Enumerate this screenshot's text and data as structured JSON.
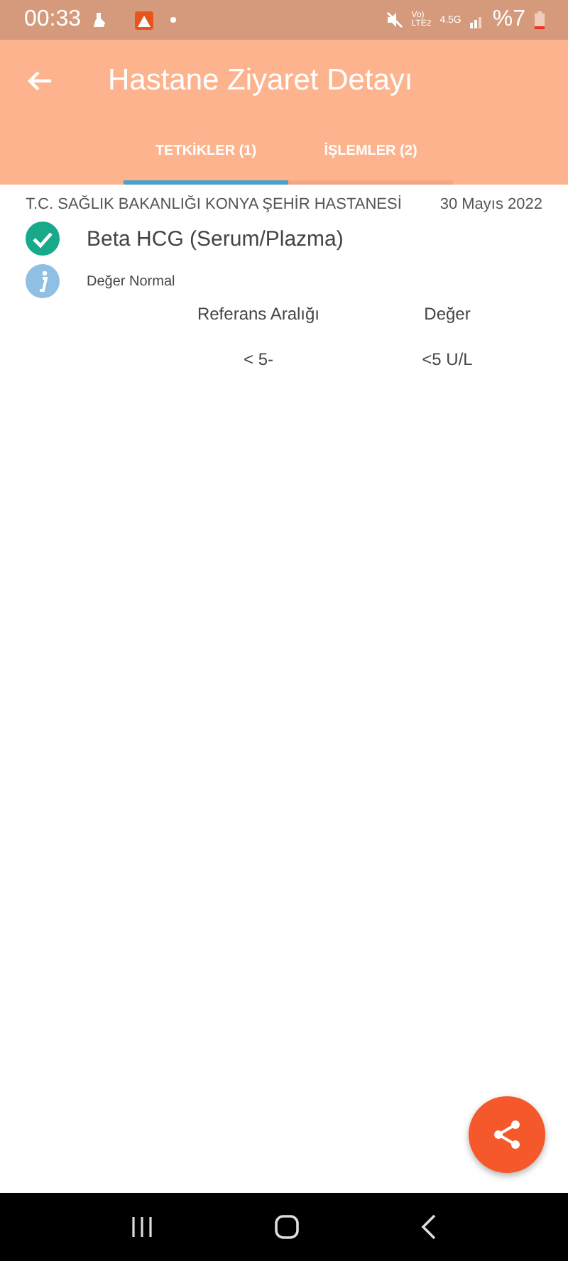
{
  "status_bar": {
    "time": "00:33",
    "volte_top": "Vo)",
    "volte_bottom": "LTE2",
    "network": "4.5G",
    "battery": "%7"
  },
  "app_bar": {
    "title": "Hastane Ziyaret Detayı"
  },
  "tabs": [
    {
      "label": "TETKİKLER (1)",
      "selected": true
    },
    {
      "label": "İŞLEMLER (2)",
      "selected": false
    }
  ],
  "visit": {
    "hospital": "T.C. SAĞLIK BAKANLIĞI KONYA ŞEHİR HASTANESİ",
    "date": "30 Mayıs 2022"
  },
  "tests": [
    {
      "name": "Beta HCG (Serum/Plazma)",
      "checked": true,
      "note": "Değer Normal",
      "columns": [
        "Referans Aralığı",
        "Değer"
      ],
      "row": [
        "< 5-",
        "<5 U/L"
      ]
    }
  ]
}
